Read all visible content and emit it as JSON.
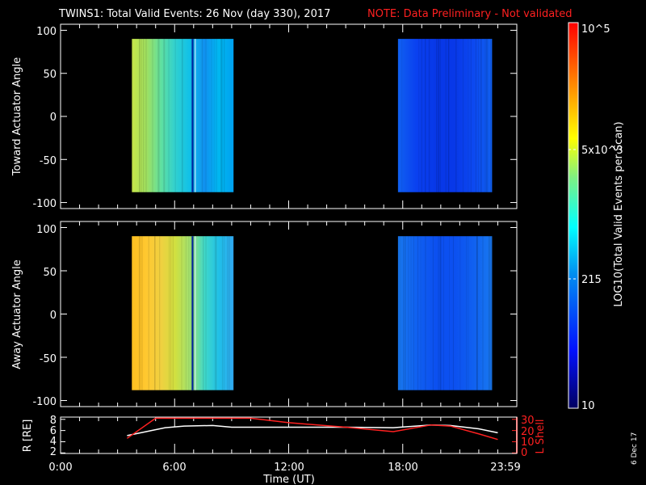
{
  "title": "TWINS1: Total Valid Events: 26 Nov (day 330), 2017",
  "note": "NOTE: Data Preliminary - Not validated",
  "date_stamp": "6 Dec 17",
  "colors": {
    "background": "#000000",
    "axes": "#ffffff",
    "lshell": "#ff2020",
    "note": "#ff2020"
  },
  "chart_data": [
    {
      "type": "heatmap",
      "name": "toward",
      "ylabel": "Toward Actuator Angle",
      "ylim": [
        -107,
        107
      ],
      "yticks": [
        "100",
        "50",
        "0",
        "-50",
        "-100"
      ],
      "ytick_values": [
        100,
        50,
        0,
        -50,
        -100
      ],
      "xlim_hours": [
        0,
        24
      ],
      "blocks": [
        {
          "t_start": 3.75,
          "t_end": 9.1,
          "angle_min": -88,
          "angle_max": 90,
          "colors": [
            "#c8e84a",
            "#a0e060",
            "#60e0a0",
            "#30d0d0",
            "#10c0e8",
            "#1090f0",
            "#00b8f0",
            "#00a0f0"
          ]
        },
        {
          "t_start": 17.75,
          "t_end": 22.7,
          "angle_min": -88,
          "angle_max": 90,
          "colors": [
            "#1060f0",
            "#0a40f0",
            "#0838e8",
            "#0838e8",
            "#0c48f0",
            "#1060f0"
          ]
        }
      ]
    },
    {
      "type": "heatmap",
      "name": "away",
      "ylabel": "Away Actuator Angle",
      "ylim": [
        -107,
        107
      ],
      "yticks": [
        "100",
        "50",
        "0",
        "-50",
        "-100"
      ],
      "ytick_values": [
        100,
        50,
        0,
        -50,
        -100
      ],
      "xlim_hours": [
        0,
        24
      ],
      "blocks": [
        {
          "t_start": 3.75,
          "t_end": 9.1,
          "angle_min": -88,
          "angle_max": 90,
          "colors": [
            "#ffc020",
            "#ffc830",
            "#f0d040",
            "#d0e040",
            "#a0e070",
            "#40d8c8",
            "#20c0e8",
            "#30a8f0"
          ]
        },
        {
          "t_start": 17.75,
          "t_end": 22.7,
          "angle_min": -88,
          "angle_max": 90,
          "colors": [
            "#1878f0",
            "#1060f0",
            "#0c50f0",
            "#0c50f0",
            "#1060f0",
            "#1878f0"
          ]
        }
      ]
    },
    {
      "type": "line",
      "name": "orbit",
      "ylabel": "R [RE]",
      "ylabel_right": "L Shell",
      "yticks": [
        "8",
        "6",
        "4",
        "2"
      ],
      "ytick_values": [
        8,
        6,
        4,
        2
      ],
      "ylim": [
        1.9,
        8.4
      ],
      "yticks_right": [
        "30",
        "20",
        "10",
        "0"
      ],
      "ytick_values_right": [
        30,
        20,
        10,
        0
      ],
      "ylim_right": [
        -0.5,
        32
      ],
      "xlabel": "Time (UT)",
      "xticks": [
        "0:00",
        "6:00",
        "12:00",
        "18:00",
        "23:59"
      ],
      "xtick_values": [
        0,
        6,
        12,
        18,
        23.98
      ],
      "series": [
        {
          "name": "R",
          "color": "#ffffff",
          "x": [
            3.5,
            4.5,
            5.5,
            6.5,
            8,
            9,
            12,
            15,
            17.5,
            19.5,
            20.5,
            22,
            23
          ],
          "y": [
            5.1,
            5.8,
            6.5,
            6.8,
            6.9,
            6.6,
            6.6,
            6.6,
            6.5,
            7.0,
            6.9,
            6.3,
            5.6
          ]
        },
        {
          "name": "L Shell",
          "color": "#ff2020",
          "x": [
            3.5,
            5.0,
            10,
            12,
            15,
            17.5,
            19.5,
            20.5,
            22,
            23
          ],
          "y": [
            13,
            31,
            31,
            27,
            23,
            19,
            25,
            24,
            17,
            12
          ]
        }
      ]
    }
  ],
  "colorbar": {
    "label": "LOG10(Total Valid Events per Scan)",
    "ticks": [
      "10^5",
      "5x10^3",
      "215",
      "10"
    ],
    "tick_values": [
      100000,
      5000,
      215,
      10
    ]
  }
}
